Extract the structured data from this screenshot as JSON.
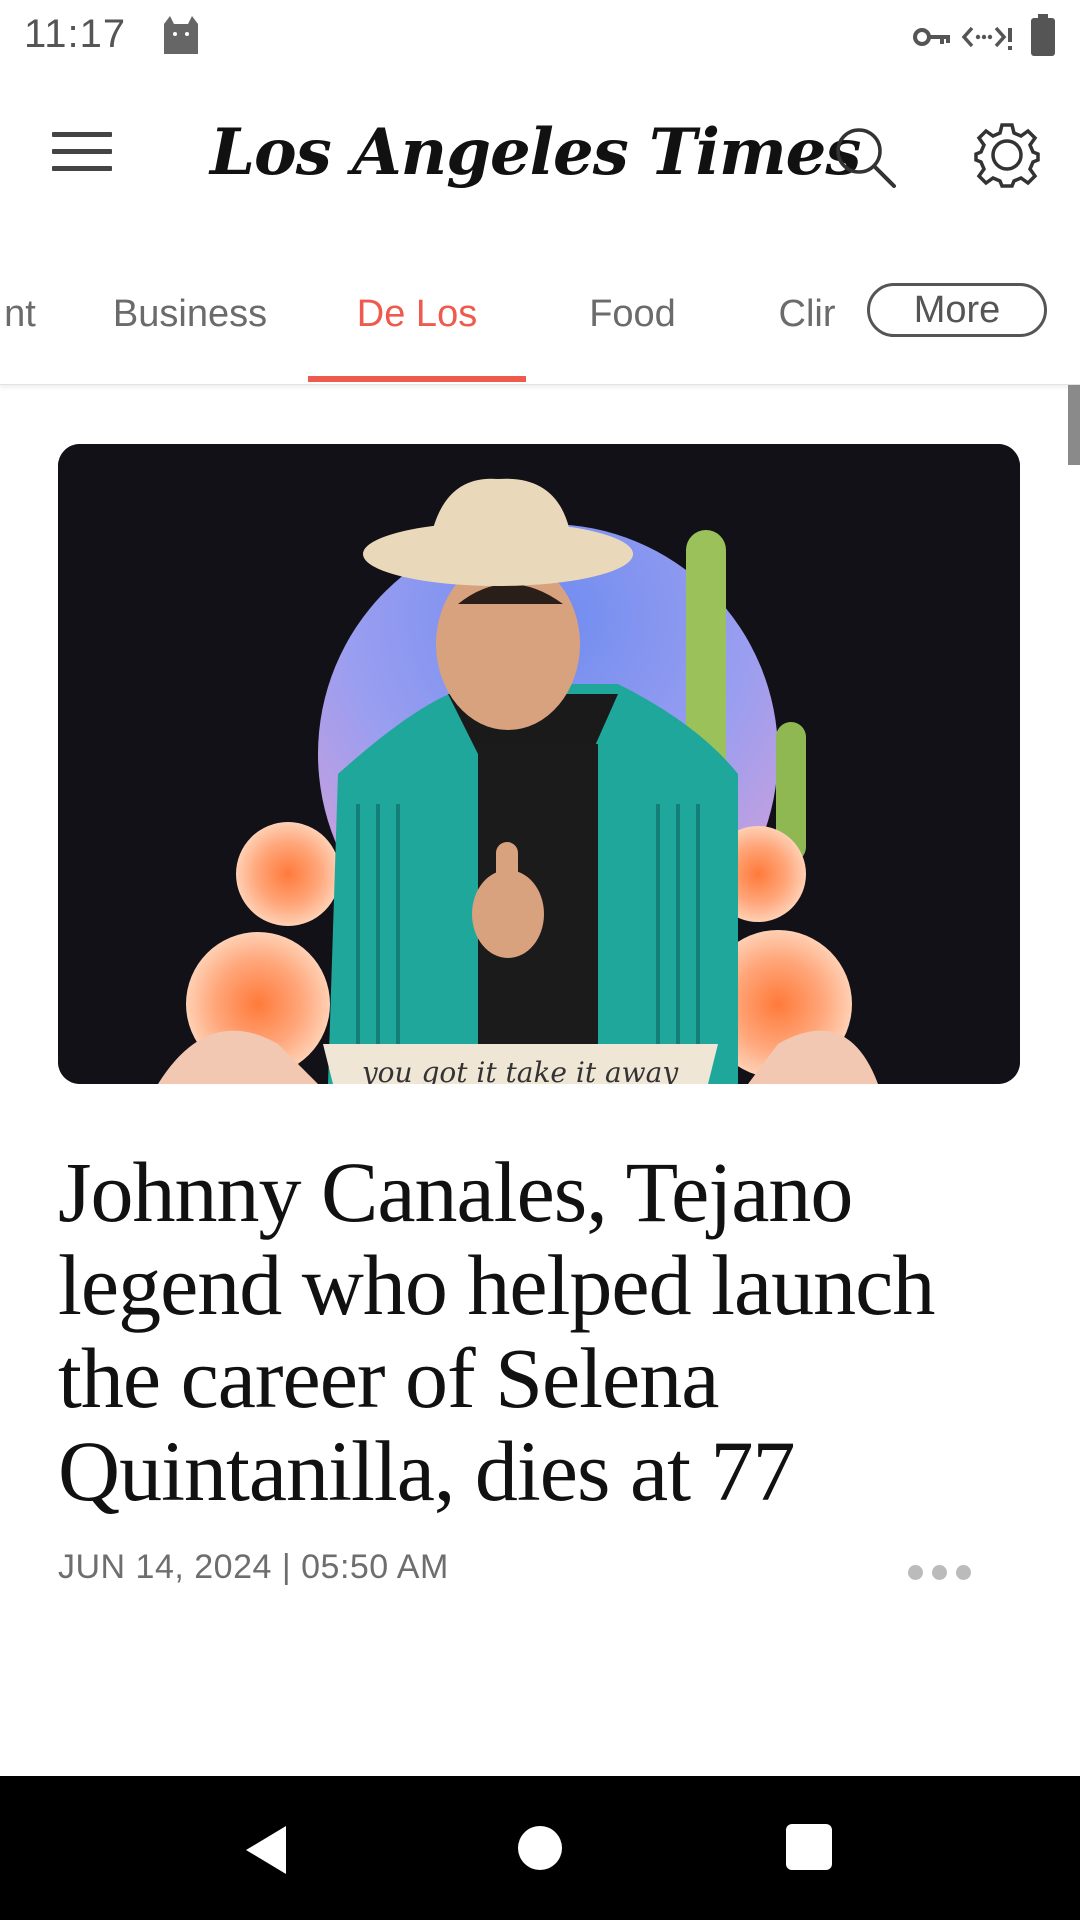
{
  "status_bar": {
    "time": "11:17"
  },
  "header": {
    "logo_text": "Los Angeles Times"
  },
  "tabs": {
    "items": [
      {
        "label": "nt"
      },
      {
        "label": "Business"
      },
      {
        "label": "De Los"
      },
      {
        "label": "Food"
      },
      {
        "label": "Clir"
      }
    ],
    "active_index": 2,
    "more_label": "More"
  },
  "article": {
    "image_caption": "you got it take it away",
    "headline": "Johnny Canales, Tejano legend who helped launch the career of Selena Quintanilla, dies at 77",
    "dateline": "JUN 14, 2024 | 05:50 AM"
  },
  "colors": {
    "accent": "#ef5a4f",
    "text": "#111111",
    "muted": "#6b6b6b",
    "nav_background": "#000000"
  },
  "icons": [
    "cat-icon",
    "vpn-key-icon",
    "network-icon",
    "battery-icon",
    "menu-icon",
    "search-icon",
    "gear-icon",
    "more-dots-icon",
    "back-icon",
    "home-icon",
    "recent-apps-icon"
  ]
}
